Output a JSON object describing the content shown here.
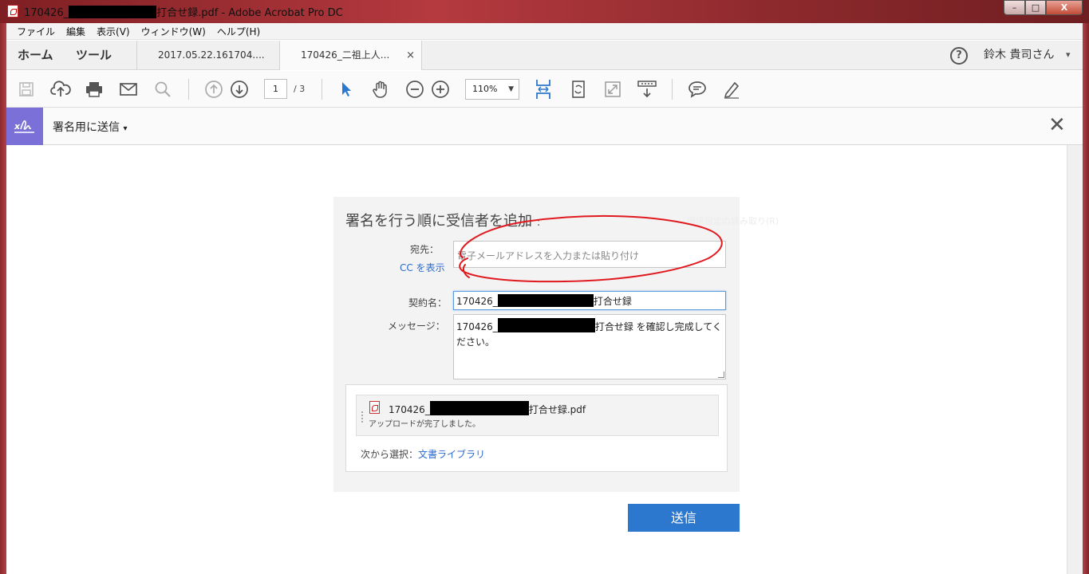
{
  "window": {
    "title_prefix": "170426_",
    "title_suffix": "打合せ録.pdf - Adobe Acrobat Pro DC",
    "controls": {
      "minimize": "–",
      "maximize": "□",
      "close": "X"
    }
  },
  "menu": {
    "items": [
      "ファイル",
      "編集",
      "表示(V)",
      "ウィンドウ(W)",
      "ヘルプ(H)"
    ]
  },
  "tabs": {
    "home": "ホーム",
    "tools": "ツール",
    "documents": [
      {
        "label": "2017.05.22.161704....",
        "active": false
      },
      {
        "label": "170426_二祖上人...",
        "active": true
      }
    ],
    "close_glyph": "×",
    "user_name": "鈴木 貴司さん",
    "help": "?"
  },
  "toolbar": {
    "page_current": "1",
    "page_total": "/ 3",
    "zoom": "110%"
  },
  "sign_bar": {
    "title": "署名用に送信",
    "close": "✕"
  },
  "form": {
    "heading": "署名を行う順に受信者を追加",
    "heading_colon": ":",
    "faint_text": "環境設定の読み取り(R)",
    "to_label": "宛先：",
    "to_placeholder": "電子メールアドレスを入力または貼り付け",
    "cc_link": "CC を表示",
    "agreement_label": "契約名：",
    "agreement_prefix": "170426_",
    "agreement_suffix": "打合せ録",
    "message_label": "メッセージ：",
    "message_prefix": "170426_",
    "message_suffix": "打合せ録 を確認し完成してく",
    "message_line2": "ださい。",
    "attachment": {
      "file_prefix": "170426_",
      "file_suffix": "打合せ録.pdf",
      "status": "アップロードが完了しました。"
    },
    "select_label": "次から選択：",
    "library_link": "文書ライブラリ",
    "send_button": "送信"
  },
  "colors": {
    "accent_blue": "#2c78cf",
    "sign_purple": "#7a70d8",
    "annotation_red": "#e0191f"
  }
}
